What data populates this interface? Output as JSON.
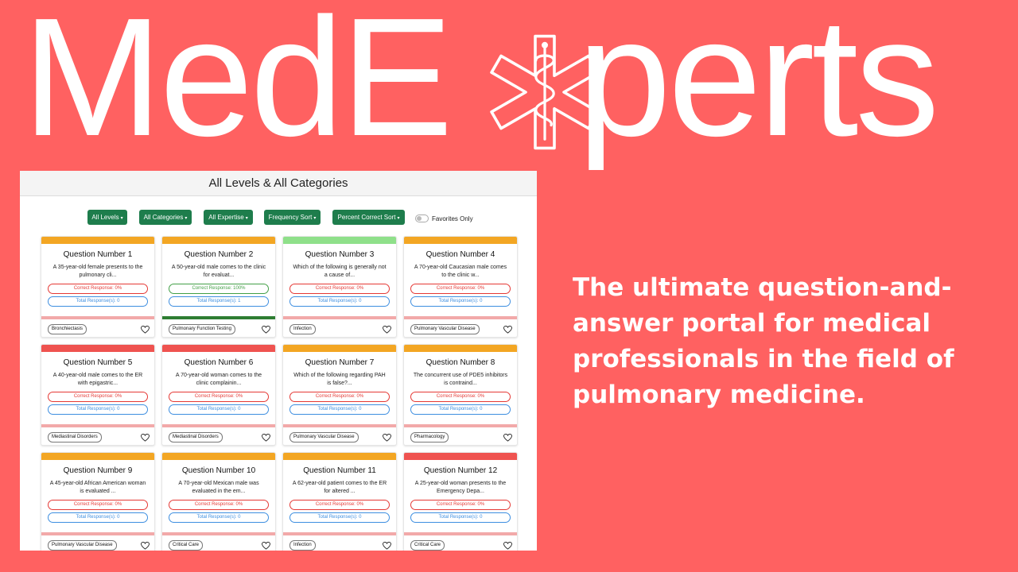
{
  "brand": {
    "name_left": "MedE",
    "name_right": "perts",
    "logo_icon": "star-of-life-icon"
  },
  "tagline": "The ultimate question-and-answer portal for medical professionals in the field of pulmonary medicine.",
  "app": {
    "header_title": "All Levels & All Categories",
    "filters": {
      "levels": "All Levels",
      "categories": "All Categories",
      "expertise": "All Expertise",
      "frequency_sort": "Frequency Sort",
      "percent_correct_sort": "Percent Correct Sort",
      "favorites_only": "Favorites Only"
    },
    "cards": [
      {
        "title": "Question Number 1",
        "desc": "A 35-year-old female presents to the pulmonary cli...",
        "correct": "Correct Response: 0%",
        "total": "Total Response(s): 0",
        "tag": "Bronchiectasis",
        "difficulty_color": "#f3a623"
      },
      {
        "title": "Question Number 2",
        "desc": "A 50-year-old male comes to the clinic for evaluat...",
        "correct": "Correct Response: 100%",
        "total": "Total Response(s): 1",
        "tag": "Pulmonary Function Testing",
        "difficulty_color": "#f3a623"
      },
      {
        "title": "Question Number 3",
        "desc": "Which of the following is generally not a cause of...",
        "correct": "Correct Response: 0%",
        "total": "Total Response(s): 0",
        "tag": "Infection",
        "difficulty_color": "#8fe08a"
      },
      {
        "title": "Question Number 4",
        "desc": "A 70-year-old Caucasian male comes to the clinic w...",
        "correct": "Correct Response: 0%",
        "total": "Total Response(s): 0",
        "tag": "Pulmonary Vascular Disease",
        "difficulty_color": "#f3a623"
      },
      {
        "title": "Question Number 5",
        "desc": "A 40-year-old male comes to the ER with epigastric...",
        "correct": "Correct Response: 0%",
        "total": "Total Response(s): 0",
        "tag": "Mediastinal Disorders",
        "difficulty_color": "#ef5350"
      },
      {
        "title": "Question Number 6",
        "desc": "A 70-year-old woman comes to the clinic complainin...",
        "correct": "Correct Response: 0%",
        "total": "Total Response(s): 0",
        "tag": "Mediastinal Disorders",
        "difficulty_color": "#ef5350"
      },
      {
        "title": "Question Number 7",
        "desc": "Which of the following regarding PAH is false?...",
        "correct": "Correct Response: 0%",
        "total": "Total Response(s): 0",
        "tag": "Pulmonary Vascular Disease",
        "difficulty_color": "#f3a623"
      },
      {
        "title": "Question Number 8",
        "desc": "The concurrent use of PDE5 inhibitors is contraind...",
        "correct": "Correct Response: 0%",
        "total": "Total Response(s): 0",
        "tag": "Pharmacology",
        "difficulty_color": "#f3a623"
      },
      {
        "title": "Question Number 9",
        "desc": "A 45-year-old African American woman is evaluated ...",
        "correct": "Correct Response: 0%",
        "total": "Total Response(s): 0",
        "tag": "Pulmonary Vascular Disease",
        "difficulty_color": "#f3a623"
      },
      {
        "title": "Question Number 10",
        "desc": "A 70-year-old Mexican male was evaluated in the em...",
        "correct": "Correct Response: 0%",
        "total": "Total Response(s): 0",
        "tag": "Critical Care",
        "difficulty_color": "#f3a623"
      },
      {
        "title": "Question Number 11",
        "desc": "A 62-year-old patient comes to the ER for altered ...",
        "correct": "Correct Response: 0%",
        "total": "Total Response(s): 0",
        "tag": "Infection",
        "difficulty_color": "#f3a623"
      },
      {
        "title": "Question Number 12",
        "desc": "A 25-year-old woman presents to the Emergency Depa...",
        "correct": "Correct Response: 0%",
        "total": "Total Response(s): 0",
        "tag": "Critical Care",
        "difficulty_color": "#ef5350"
      }
    ]
  },
  "colors": {
    "background": "#ff6161",
    "filter_button": "#1e7d4c",
    "correct_pill": "#e53935",
    "total_pill": "#3d8ee0"
  }
}
